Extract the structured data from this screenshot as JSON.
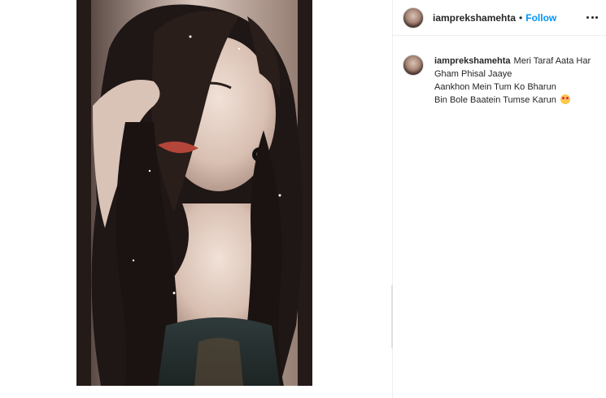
{
  "post": {
    "username": "iamprekshamehta",
    "separator": "•",
    "follow_label": "Follow",
    "more_icon": "more-horizontal-icon",
    "caption": {
      "username": "iamprekshamehta",
      "line1": "Meri Taraf Aata Har",
      "line2": "Gham Phisal Jaaye",
      "line3": "Aankhon Mein Tum Ko Bharun",
      "line4": "Bin Bole Baatein Tumse Karun",
      "emoji": "smiling-face-with-hearts-icon"
    },
    "photo": {
      "description_icon": "portrait-photo"
    }
  },
  "colors": {
    "follow": "#0095f6",
    "text": "#262626",
    "divider": "#efefef"
  }
}
